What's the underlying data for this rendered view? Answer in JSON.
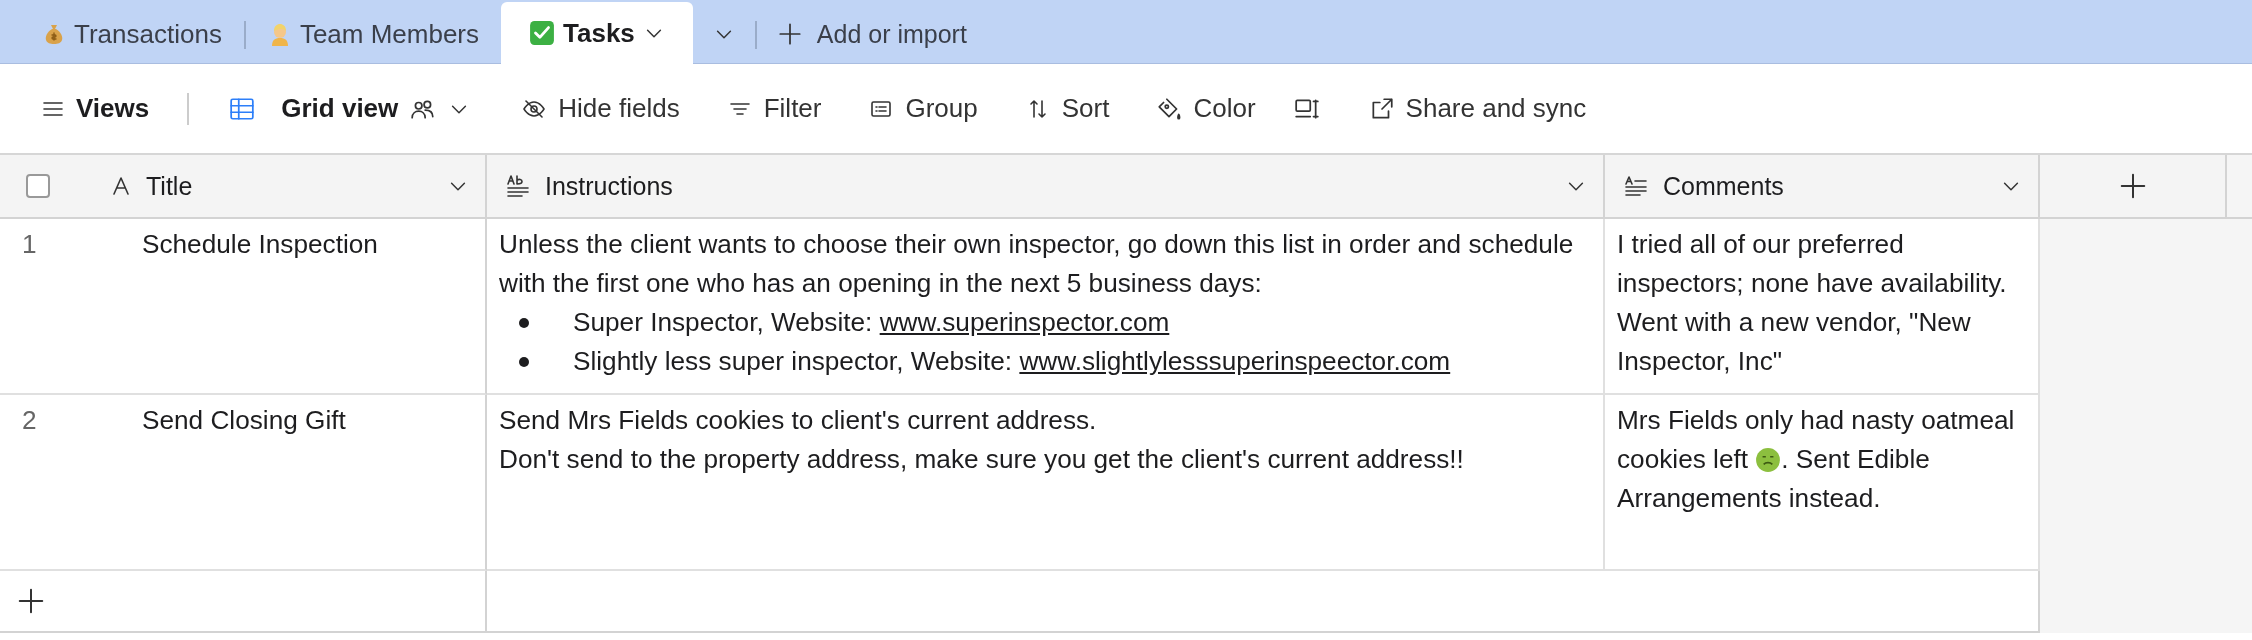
{
  "tabs": [
    {
      "label": "Transactions",
      "selected": false
    },
    {
      "label": "Team Members",
      "selected": false
    },
    {
      "label": "Tasks",
      "selected": true
    }
  ],
  "add_tab": "Add or import",
  "toolbar": {
    "views": "Views",
    "view_name": "Grid view",
    "buttons": [
      "Hide fields",
      "Filter",
      "Group",
      "Sort",
      "Color",
      "Share and sync"
    ]
  },
  "table": {
    "select_all_checked": false,
    "columns": [
      {
        "name": "Title"
      },
      {
        "name": "Instructions"
      },
      {
        "name": "Comments"
      }
    ],
    "rows": [
      {
        "number": "1",
        "title": "Schedule Inspection",
        "instructions": {
          "lines": [
            "Unless the client wants to choose their own inspector, go down this list in order and schedule with the first one who has an opening in the next 5 business days:"
          ],
          "bullets": [
            {
              "text": "Super Inspector, Website: ",
              "link": "www.superinspector.com"
            },
            {
              "text": "Slightly less super inspector, Website: ",
              "link": "www.slightlylesssuperinspeector.com"
            }
          ]
        },
        "comments": [
          "I tried all of our preferred inspectors; none have availability. Went with a new vendor, \"New Inspector, Inc\""
        ]
      },
      {
        "number": "2",
        "title": "Send Closing Gift",
        "instructions": {
          "lines": [
            "Send Mrs Fields cookies to client's current address.",
            "Don't send to the property address, make sure you get the client's current address!!"
          ]
        },
        "comments": [
          "Mrs Fields only had nasty oatmeal cookies left ",
          ". Sent Edible Arrangements instead."
        ]
      }
    ]
  }
}
